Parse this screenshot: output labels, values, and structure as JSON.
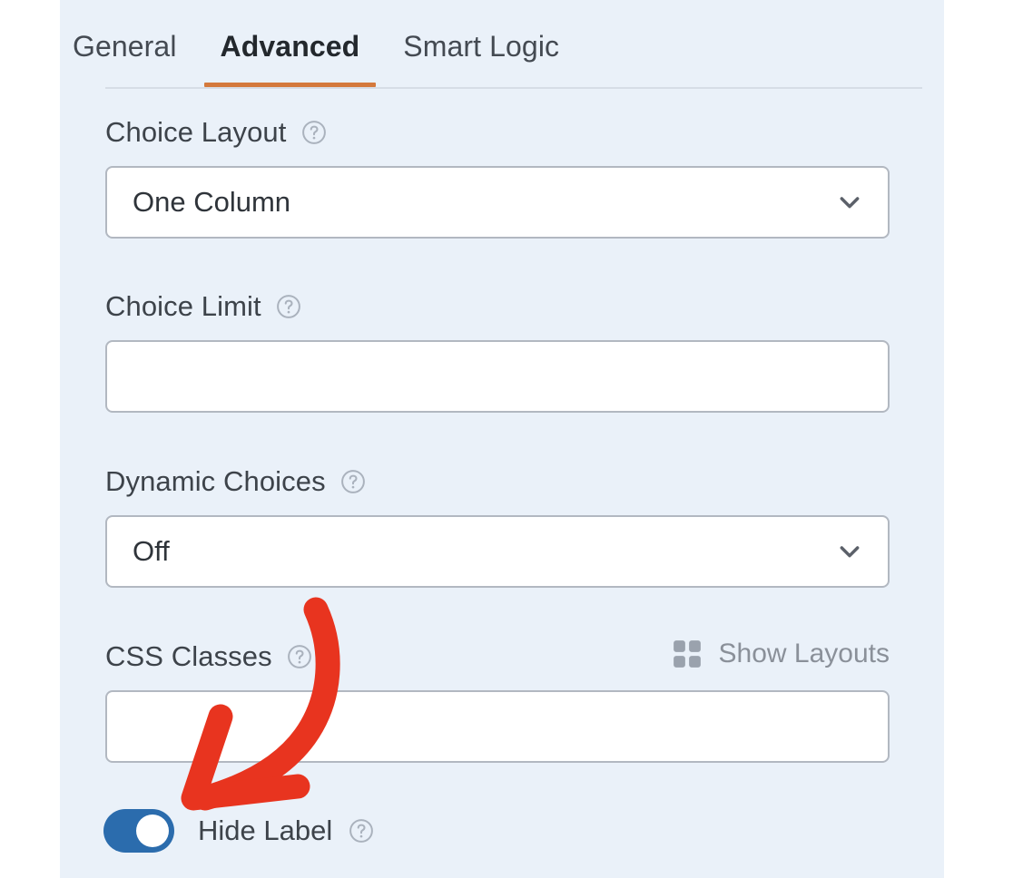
{
  "panel": {
    "background_color": "#eaf1f9"
  },
  "tabs": {
    "items": [
      {
        "label": "General",
        "active": false
      },
      {
        "label": "Advanced",
        "active": true
      },
      {
        "label": "Smart Logic",
        "active": false
      }
    ],
    "active_underline_color": "#d4793c"
  },
  "fields": {
    "choice_layout": {
      "label": "Choice Layout",
      "help_icon": "help-circle-icon",
      "value": "One Column",
      "dropdown_icon": "chevron-down-icon"
    },
    "choice_limit": {
      "label": "Choice Limit",
      "help_icon": "help-circle-icon",
      "value": "",
      "placeholder": ""
    },
    "dynamic_choices": {
      "label": "Dynamic Choices",
      "help_icon": "help-circle-icon",
      "value": "Off",
      "dropdown_icon": "chevron-down-icon"
    },
    "css_classes": {
      "label": "CSS Classes",
      "help_icon": "help-circle-icon",
      "value": "",
      "placeholder": "",
      "show_layouts_label": "Show Layouts",
      "show_layouts_icon": "grid-2x2-icon"
    },
    "hide_label": {
      "label": "Hide Label",
      "help_icon": "help-circle-icon",
      "toggle_state": "on",
      "toggle_on_color": "#2b6cad"
    }
  },
  "annotation": {
    "type": "curved-arrow",
    "color": "#e8341f",
    "points_to": "hide-label-toggle"
  }
}
